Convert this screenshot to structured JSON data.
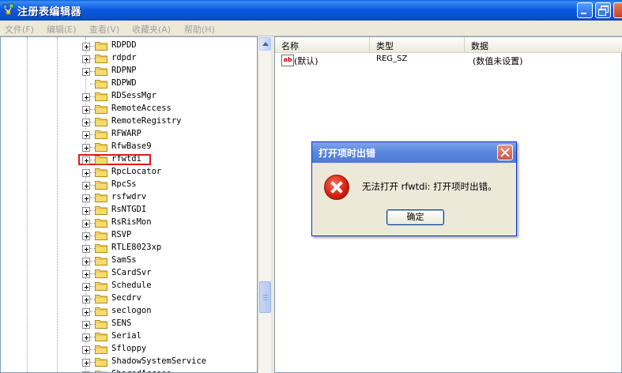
{
  "window": {
    "title": "注册表编辑器",
    "icon": "regedit-icon"
  },
  "menu": [
    "文件(F)",
    "编辑(E)",
    "查看(V)",
    "收藏夹(A)",
    "帮助(H)"
  ],
  "tree": {
    "items": [
      {
        "label": "RDPDD",
        "expandable": true
      },
      {
        "label": "rdpdr",
        "expandable": true
      },
      {
        "label": "RDPNP",
        "expandable": true
      },
      {
        "label": "RDPWD",
        "expandable": false
      },
      {
        "label": "RDSessMgr",
        "expandable": true
      },
      {
        "label": "RemoteAccess",
        "expandable": true
      },
      {
        "label": "RemoteRegistry",
        "expandable": true
      },
      {
        "label": "RFWARP",
        "expandable": true
      },
      {
        "label": "RfwBase9",
        "expandable": true
      },
      {
        "label": "rfwtdi",
        "expandable": true,
        "highlighted": true
      },
      {
        "label": "RpcLocator",
        "expandable": true
      },
      {
        "label": "RpcSs",
        "expandable": true
      },
      {
        "label": "rsfwdrv",
        "expandable": true
      },
      {
        "label": "RsNTGDI",
        "expandable": true
      },
      {
        "label": "RsRisMon",
        "expandable": true
      },
      {
        "label": "RSVP",
        "expandable": true
      },
      {
        "label": "RTLE8023xp",
        "expandable": true
      },
      {
        "label": "SamSs",
        "expandable": true
      },
      {
        "label": "SCardSvr",
        "expandable": true
      },
      {
        "label": "Schedule",
        "expandable": true
      },
      {
        "label": "Secdrv",
        "expandable": true
      },
      {
        "label": "seclogon",
        "expandable": true
      },
      {
        "label": "SENS",
        "expandable": true
      },
      {
        "label": "Serial",
        "expandable": true
      },
      {
        "label": "Sfloppy",
        "expandable": true
      },
      {
        "label": "ShadowSystemService",
        "expandable": true
      },
      {
        "label": "SharedAccess",
        "expandable": true
      }
    ]
  },
  "list": {
    "columns": [
      "名称",
      "类型",
      "数据"
    ],
    "rows": [
      {
        "name": "(默认)",
        "type": "REG_SZ",
        "data": "(数值未设置)",
        "icon": "string-value-icon"
      }
    ]
  },
  "dialog": {
    "title": "打开项时出错",
    "message": "无法打开 rfwtdi: 打开项时出错。",
    "ok_label": "确定",
    "icon": "error-icon"
  },
  "colors": {
    "titlebar": "#0a4fcf",
    "highlight_box": "#e01818",
    "error_red": "#d21c0c"
  }
}
